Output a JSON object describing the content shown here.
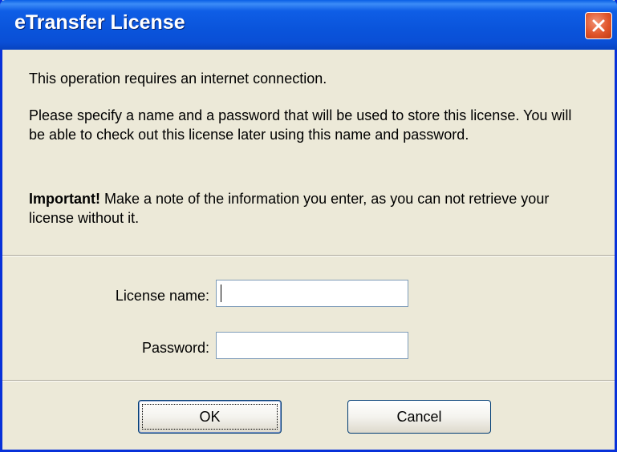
{
  "window": {
    "title": "eTransfer License",
    "close_icon": "close-icon"
  },
  "content": {
    "intro": "This operation requires an internet connection.",
    "instructions": "Please specify a name and a password that will be used to store this license. You will be able to check out this license later using this name and password.",
    "important_label": "Important!",
    "important_text": " Make a note of the information you enter, as you can not retrieve your license without it."
  },
  "form": {
    "license_name_label": "License name:",
    "license_name_value": "",
    "password_label": "Password:",
    "password_value": ""
  },
  "buttons": {
    "ok_label": "OK",
    "cancel_label": "Cancel"
  },
  "colors": {
    "titlebar": "#0a54db",
    "dialog_bg": "#ece9d8",
    "close_button": "#e0552b"
  }
}
